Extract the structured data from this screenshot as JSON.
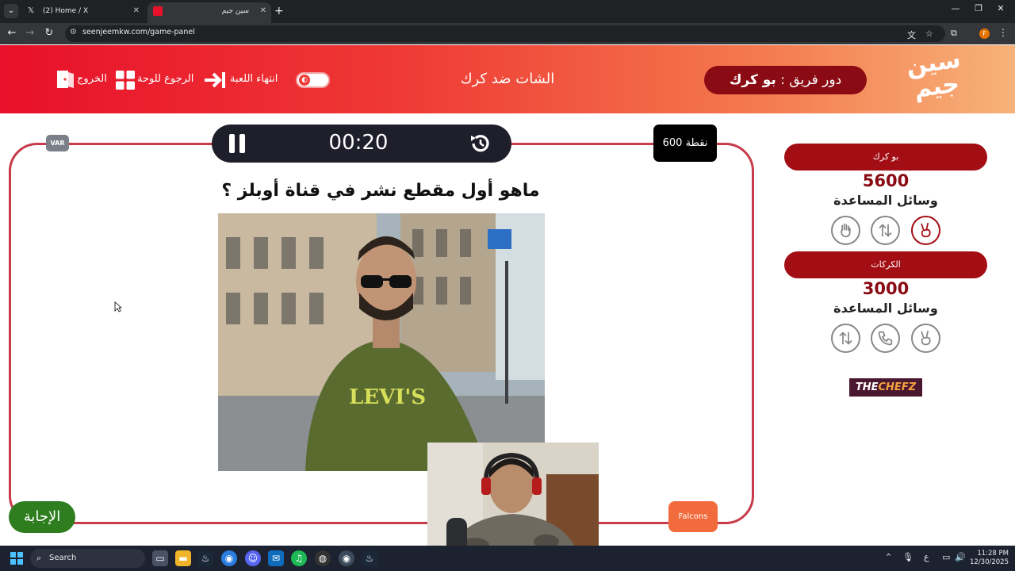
{
  "browser": {
    "tabs": [
      {
        "title": "(2) Home / X",
        "icon": "x-logo-icon"
      },
      {
        "title": "سين جيم",
        "icon": "site-favicon"
      }
    ],
    "url": "seenjeemkw.com/game-panel",
    "profile_initial": "F"
  },
  "header": {
    "logo_line1": "سين",
    "logo_line2": "جيم",
    "turn_label": "دور فريق : ",
    "turn_team": "بو كرك",
    "game_title": "الشات ضد كرك",
    "end_game_label": "انتهاء اللعبة",
    "back_to_board_label": "الرجوع للوحة",
    "exit_label": "الخروج"
  },
  "board": {
    "var_label": "VAR",
    "timer": "00:20",
    "points": "600 نقطة",
    "question": "ماهو أول مقطع نشر في قناة أوبلز ؟",
    "answer_label": "الإجابة",
    "team_badge": "Falcons"
  },
  "sidebar": {
    "teams": [
      {
        "name": "بو كرك",
        "score": "5600",
        "helpers_label": "وسائل المساعدة",
        "helpers": [
          "hand-stop-icon",
          "two-arrows-icon",
          "victory-hand-icon"
        ],
        "active_helper": 2
      },
      {
        "name": "الكركات",
        "score": "3000",
        "helpers_label": "وسائل المساعدة",
        "helpers": [
          "two-arrows-icon",
          "phone-icon",
          "victory-hand-icon"
        ],
        "active_helper": -1
      }
    ],
    "sponsor_a": "THE",
    "sponsor_b": "CHEFZ"
  },
  "taskbar": {
    "search_placeholder": "Search",
    "keyboard_lang": "ع",
    "time": "11:28 PM",
    "date": "12/30/2025"
  },
  "colors": {
    "accent_red": "#a30d14",
    "board_border": "#c73b4a",
    "answer_green": "#2e7d1f",
    "team_orange": "#f26b3c"
  }
}
